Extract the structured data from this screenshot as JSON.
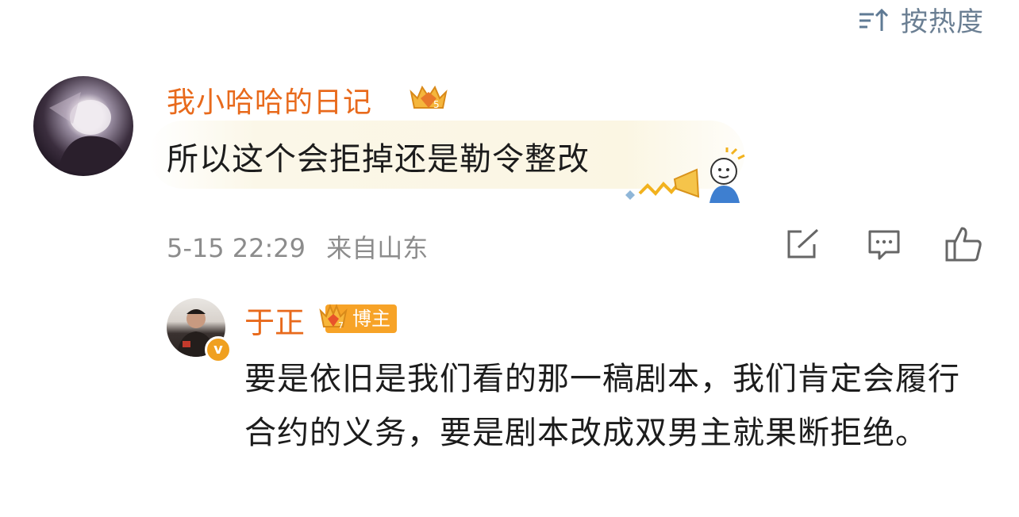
{
  "sort": {
    "label": "按热度",
    "icon": "sort-icon"
  },
  "comment": {
    "username": "我小哈哈的日记",
    "badge_icon": "fan-crown-icon",
    "text": "所以这个会拒掉还是勒令整改",
    "timestamp": "5-15 22:29",
    "location": "来自山东",
    "actions": {
      "share_icon": "share-icon",
      "reply_icon": "comment-icon",
      "like_icon": "thumbs-up-icon"
    }
  },
  "reply": {
    "username": "于正",
    "badge_label": "博主",
    "verified_mark": "v",
    "text": "要是依旧是我们看的那一稿剧本，我们肯定会履行合约的义务，要是剧本改成双男主就果断拒绝。"
  },
  "colors": {
    "username": "#e86a1c",
    "meta": "#8c8c8c",
    "badge": "#f7a327",
    "bubble": "#fbf7e8"
  }
}
